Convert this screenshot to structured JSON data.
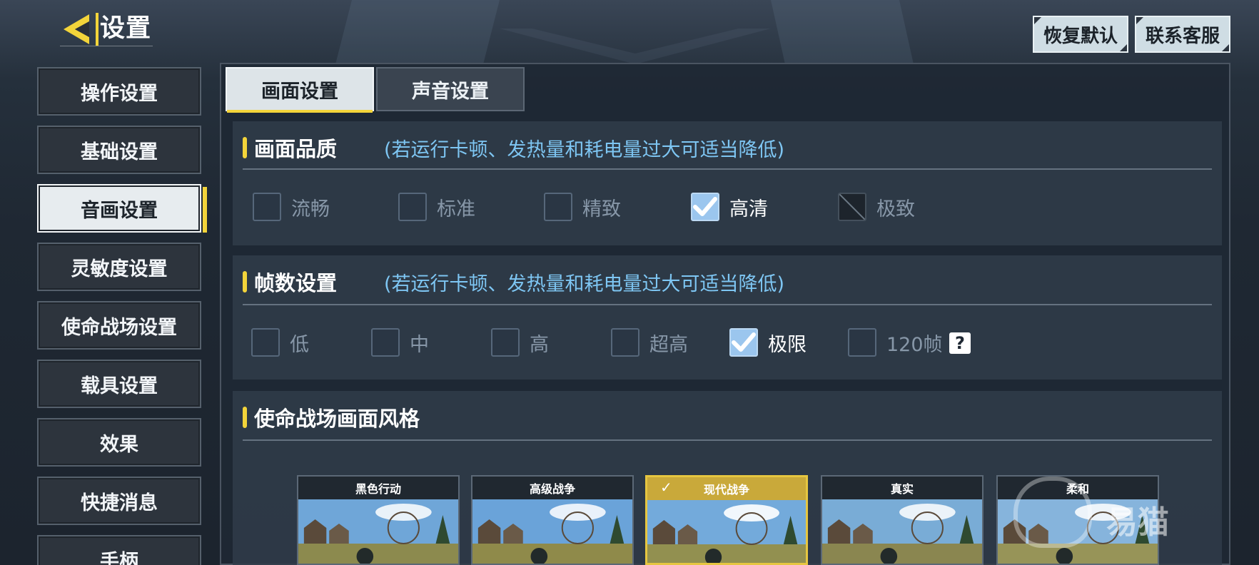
{
  "header": {
    "back_icon": "back-arrow-icon",
    "title": "设置",
    "reset_label": "恢复默认",
    "support_label": "联系客服"
  },
  "sidebar": {
    "items": [
      {
        "label": "操作设置",
        "active": false
      },
      {
        "label": "基础设置",
        "active": false
      },
      {
        "label": "音画设置",
        "active": true
      },
      {
        "label": "灵敏度设置",
        "active": false
      },
      {
        "label": "使命战场设置",
        "active": false
      },
      {
        "label": "载具设置",
        "active": false
      },
      {
        "label": "效果",
        "active": false
      },
      {
        "label": "快捷消息",
        "active": false
      },
      {
        "label": "手柄",
        "active": false
      }
    ]
  },
  "tabs": [
    {
      "label": "画面设置",
      "active": true
    },
    {
      "label": "声音设置",
      "active": false
    }
  ],
  "quality": {
    "title": "画面品质",
    "hint": "(若运行卡顿、发热量和耗电量过大可适当降低)",
    "options": [
      {
        "label": "流畅",
        "state": "unchecked"
      },
      {
        "label": "标准",
        "state": "unchecked"
      },
      {
        "label": "精致",
        "state": "unchecked"
      },
      {
        "label": "高清",
        "state": "checked"
      },
      {
        "label": "极致",
        "state": "disabled"
      }
    ]
  },
  "fps": {
    "title": "帧数设置",
    "hint": "(若运行卡顿、发热量和耗电量过大可适当降低)",
    "options": [
      {
        "label": "低",
        "state": "unchecked"
      },
      {
        "label": "中",
        "state": "unchecked"
      },
      {
        "label": "高",
        "state": "unchecked"
      },
      {
        "label": "超高",
        "state": "unchecked"
      },
      {
        "label": "极限",
        "state": "checked"
      },
      {
        "label": "120帧",
        "state": "unchecked"
      }
    ],
    "help_icon": "question-mark-icon",
    "help_glyph": "?"
  },
  "style": {
    "title": "使命战场画面风格",
    "cards": [
      {
        "label": "黑色行动",
        "selected": false
      },
      {
        "label": "高级战争",
        "selected": false
      },
      {
        "label": "现代战争",
        "selected": true
      },
      {
        "label": "真实",
        "selected": false
      },
      {
        "label": "柔和",
        "selected": false
      }
    ]
  },
  "watermark": {
    "text": "易猫"
  },
  "colors": {
    "accent_yellow": "#f3d43a",
    "hint_blue": "#7ec6f3",
    "checked_box": "#9bc6ee"
  }
}
